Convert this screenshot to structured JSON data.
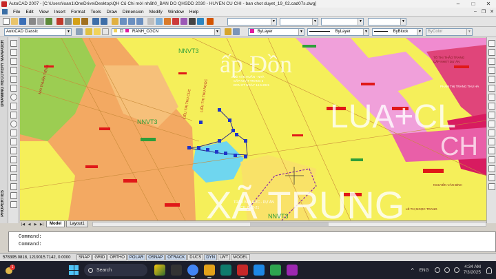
{
  "window": {
    "title": "AutoCAD 2007 - [C:\\Users\\loan1\\OneDrive\\Desktop\\QH Củ Chi mới nhất\\0_BAN DO QHSDD 2030 - HUYEN CU CHI - ban chot duyet_19_02.cad07s.dwg]",
    "controls": [
      "–",
      "□",
      "✕"
    ]
  },
  "menu": [
    "File",
    "Edit",
    "View",
    "Insert",
    "Format",
    "Tools",
    "Draw",
    "Dimension",
    "Modify",
    "Window",
    "Help"
  ],
  "toolbar": {
    "workspace": "AutoCAD Classic",
    "layer": "RANH_CGCN",
    "color": "ByLayer",
    "linetype": "ByLayer",
    "lineweight": "ByBlock",
    "plotstyle": "ByColor"
  },
  "side_labels": {
    "drc": "DRAWING RECOVERY MANAGER",
    "properties": "PROPERTIES"
  },
  "map_labels": {
    "big1": "ấp Đồn",
    "big2": "LUA+CL",
    "big3": "XÃ TRUNG",
    "big4": "CH",
    "nnvt1": "NNVT3",
    "nnvt2": "NNVT3",
    "nnvt3": "NNVT3",
    "road1": "MAI THUẬN TIẾN A",
    "road2": "LIÊU THỊ THU CÚC",
    "road3": "LIÊU THỊ THU NGỌC",
    "owner1": "VÕ VĂN HUẤN - NHÀ",
    "owner1b": "CẤP NHẬT TRANG 3",
    "owner1c": "ĐCN CT NGÀY 14.6.2021",
    "owner2": "TRẦN VĂN ĐỨC - DỰ ÁN",
    "owner2b": "CH: 8-12-21",
    "owner3": "TÔ THỊ THẢO TRANG",
    "owner3b": "CẤP NHẬT DỰ ÁN",
    "owner4": "PHẠM THỊ TRANG THU HÀ",
    "owner5": "NGUYỄN VĂN BÌNH",
    "owner6": "LÊ THỊ NGỌC TRANG"
  },
  "tabs": [
    "Model",
    "Layout1"
  ],
  "command": {
    "line1": "Command:",
    "line2": "Command:"
  },
  "status": {
    "coords": "578395.0818, 1219015.7142, 0.0000",
    "buttons": [
      "SNAP",
      "GRID",
      "ORTHO",
      "POLAR",
      "OSNAP",
      "OTRACK",
      "DUCS",
      "DYN",
      "LWT",
      "MODEL"
    ]
  },
  "taskbar": {
    "weather_badge": "1",
    "search": "Search",
    "lang": "ENG",
    "time": "4:34 AM",
    "date": "7/3/2025"
  },
  "colors": {
    "yellow_zone": "#f5ef5a",
    "orange_zone": "#f2b36f",
    "pink_zone": "#f08bd0",
    "magenta_zone": "#e0457a",
    "red_zone": "#d81b60",
    "water": "#6fd6ef",
    "green_zone": "#9ccd52",
    "marker_red": "#e01818",
    "vertex_blue": "#1f34c8"
  }
}
